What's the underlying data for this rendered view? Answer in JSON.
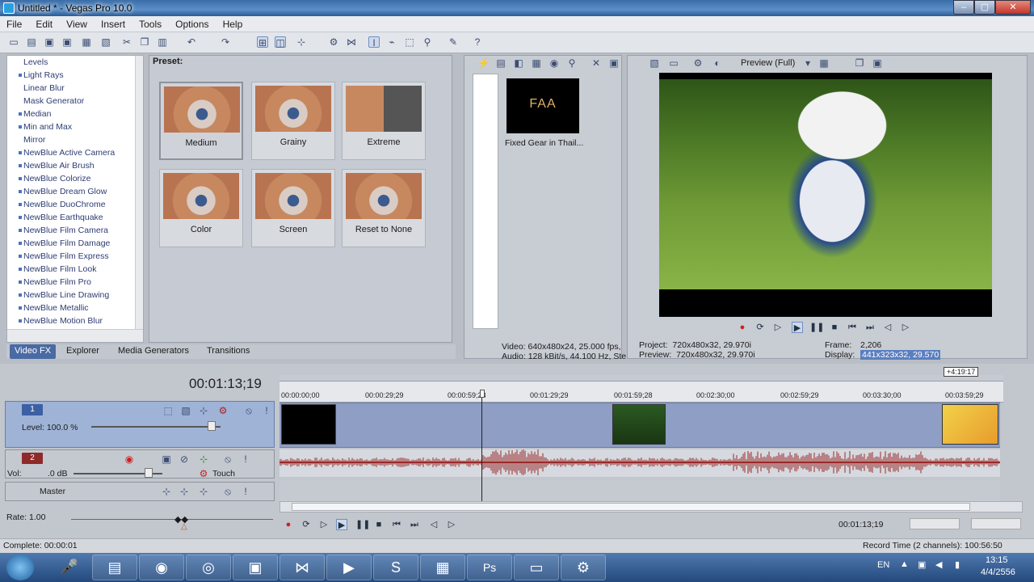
{
  "window": {
    "title": "Untitled * - Vegas Pro 10.0",
    "min": "–",
    "max": "▢",
    "close": "✕"
  },
  "menu": [
    "File",
    "Edit",
    "View",
    "Insert",
    "Tools",
    "Options",
    "Help"
  ],
  "fx_list": {
    "items": [
      {
        "label": "Levels",
        "bullet": false
      },
      {
        "label": "Light Rays",
        "bullet": true
      },
      {
        "label": "Linear Blur",
        "bullet": false
      },
      {
        "label": "Mask Generator",
        "bullet": false
      },
      {
        "label": "Median",
        "bullet": true
      },
      {
        "label": "Min and Max",
        "bullet": true
      },
      {
        "label": "Mirror",
        "bullet": false
      },
      {
        "label": "NewBlue Active Camera",
        "bullet": true
      },
      {
        "label": "NewBlue Air Brush",
        "bullet": true
      },
      {
        "label": "NewBlue Colorize",
        "bullet": true
      },
      {
        "label": "NewBlue Dream Glow",
        "bullet": true
      },
      {
        "label": "NewBlue DuoChrome",
        "bullet": true
      },
      {
        "label": "NewBlue Earthquake",
        "bullet": true
      },
      {
        "label": "NewBlue Film Camera",
        "bullet": true
      },
      {
        "label": "NewBlue Film Damage",
        "bullet": true
      },
      {
        "label": "NewBlue Film Express",
        "bullet": true
      },
      {
        "label": "NewBlue Film Look",
        "bullet": true
      },
      {
        "label": "NewBlue Film Pro",
        "bullet": true
      },
      {
        "label": "NewBlue Line Drawing",
        "bullet": true
      },
      {
        "label": "NewBlue Metallic",
        "bullet": true
      },
      {
        "label": "NewBlue Motion Blur",
        "bullet": true
      }
    ]
  },
  "presets": {
    "label": "Preset:",
    "items": [
      "Medium",
      "Grainy",
      "Extreme",
      "Color",
      "Screen",
      "Reset to None"
    ]
  },
  "bottom_tabs": [
    "Video FX",
    "Explorer",
    "Media Generators",
    "Transitions"
  ],
  "media": {
    "thumb_text": "FAA",
    "file_name": "Fixed Gear in Thail...",
    "info_video": "Video: 640x480x24, 25.000 fps,",
    "info_audio": "Audio: 128 kBit/s, 44.100 Hz, Ste"
  },
  "preview": {
    "mode": "Preview (Full)",
    "project": "Project:  720x480x32, 29.970i",
    "preview": "Preview:  720x480x32, 29.970i",
    "frame_label": "Frame:",
    "frame_value": "2,206",
    "display_label": "Display:",
    "display_value": "441x323x32, 29.570"
  },
  "timeline": {
    "timecode": "00:01:13;19",
    "length_badge": "+4:19:17",
    "ruler": [
      "00:00:00;00",
      "00:00:29;29",
      "00:00:59;28",
      "00:01:29;29",
      "00:01:59;28",
      "00:02:30;00",
      "00:02:59;29",
      "00:03:30;00",
      "00:03:59;29"
    ],
    "track1": {
      "num": "1",
      "level": "Level: 100.0 %"
    },
    "track2": {
      "num": "2",
      "vol_label": "Vol:",
      "vol_value": ".0 dB",
      "mode": "Touch"
    },
    "master": "Master",
    "rate": "Rate: 1.00",
    "cursor_time": "00:01:13;19",
    "record_time": "Record Time (2 channels): 100:56:50"
  },
  "status": {
    "complete": "Complete: 00:00:01"
  },
  "tray": {
    "lang": "EN",
    "time": "13:15",
    "date": "4/4/2556"
  },
  "colors": {
    "accent": "#4a6aa3",
    "video_track": "#8e9ec4",
    "audio_wave": "#9b2a2a"
  }
}
